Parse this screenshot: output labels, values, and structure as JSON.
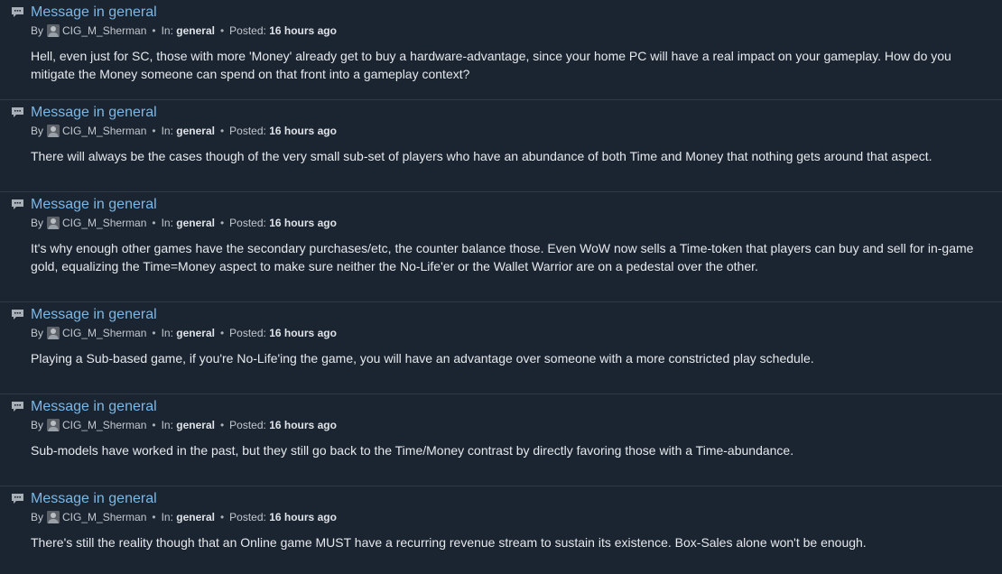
{
  "messages": [
    {
      "title": "Message in general",
      "by_label": "By",
      "author": "CIG_M_Sherman",
      "in_label": "In:",
      "channel": "general",
      "posted_label": "Posted:",
      "posted": "16 hours ago",
      "body": "Hell, even just for SC, those with more 'Money' already get to buy a hardware-advantage, since your home PC will have a real impact on your gameplay. How do you mitigate the Money someone can spend on that front into a gameplay context?"
    },
    {
      "title": "Message in general",
      "by_label": "By",
      "author": "CIG_M_Sherman",
      "in_label": "In:",
      "channel": "general",
      "posted_label": "Posted:",
      "posted": "16 hours ago",
      "body": "There will always be the cases though of the very small sub-set of players who have an abundance of both Time and Money that nothing gets around that aspect."
    },
    {
      "title": "Message in general",
      "by_label": "By",
      "author": "CIG_M_Sherman",
      "in_label": "In:",
      "channel": "general",
      "posted_label": "Posted:",
      "posted": "16 hours ago",
      "body": "It's why enough other games have the secondary purchases/etc, the counter balance those. Even WoW now sells a Time-token that players can buy and sell for in-game gold, equalizing the Time=Money aspect to make sure neither the No-Life'er or the Wallet Warrior are on a pedestal over the other."
    },
    {
      "title": "Message in general",
      "by_label": "By",
      "author": "CIG_M_Sherman",
      "in_label": "In:",
      "channel": "general",
      "posted_label": "Posted:",
      "posted": "16 hours ago",
      "body": "Playing a Sub-based game, if you're No-Life'ing the game, you will have an advantage over someone with a more constricted play schedule."
    },
    {
      "title": "Message in general",
      "by_label": "By",
      "author": "CIG_M_Sherman",
      "in_label": "In:",
      "channel": "general",
      "posted_label": "Posted:",
      "posted": "16 hours ago",
      "body": "Sub-models have worked in the past, but they still go back to the Time/Money contrast by directly favoring those with a Time-abundance."
    },
    {
      "title": "Message in general",
      "by_label": "By",
      "author": "CIG_M_Sherman",
      "in_label": "In:",
      "channel": "general",
      "posted_label": "Posted:",
      "posted": "16 hours ago",
      "body": "There's still the reality though that an Online game MUST have a recurring revenue stream to sustain its existence. Box-Sales alone won't be enough."
    }
  ],
  "colors": {
    "background": "#1b2431",
    "title_link": "#7ab8e6",
    "divider": "#2f3b4a"
  },
  "icons": {
    "message": "chat-bubble-icon",
    "avatar": "user-avatar"
  }
}
